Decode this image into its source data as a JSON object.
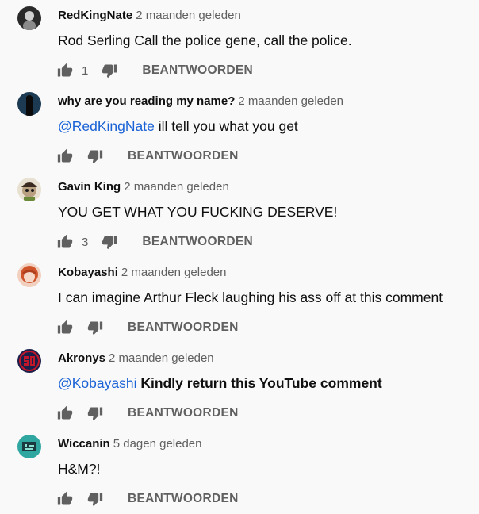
{
  "comments": [
    {
      "author": "RedKingNate",
      "time": "2 maanden geleden",
      "mention": "",
      "text": "Rod Serling Call the police gene, call the police.",
      "likes": "1",
      "reply_label": "BEANTWOORDEN",
      "avatar_colors": [
        "#2a2a2a",
        "#d0d0d0"
      ]
    },
    {
      "author": "why are you reading my name?",
      "time": "2 maanden geleden",
      "mention": "@RedKingNate",
      "text": " ill tell you what you get",
      "likes": "",
      "reply_label": "BEANTWOORDEN",
      "avatar_colors": [
        "#1c3a52",
        "#0a0a0a"
      ]
    },
    {
      "author": "Gavin King",
      "time": "2 maanden geleden",
      "mention": "",
      "text": "YOU GET WHAT YOU FUCKING DESERVE!",
      "likes": "3",
      "reply_label": "BEANTWOORDEN",
      "avatar_colors": [
        "#e8e0d0",
        "#8a6a4a"
      ]
    },
    {
      "author": "Kobayashi",
      "time": "2 maanden geleden",
      "mention": "",
      "text": "I can imagine Arthur Fleck laughing his ass off at this comment",
      "likes": "",
      "reply_label": "BEANTWOORDEN",
      "avatar_colors": [
        "#f2d0c0",
        "#d0542a"
      ]
    },
    {
      "author": "Akronys",
      "time": "2 maanden geleden",
      "mention": "@Kobayashi",
      "text": " Kindly return this YouTube comment",
      "likes": "",
      "reply_label": "BEANTWOORDEN",
      "avatar_colors": [
        "#1a1f4a",
        "#c0182a"
      ]
    },
    {
      "author": "Wiccanin",
      "time": "5 dagen geleden",
      "mention": "",
      "text": "H&M?!",
      "likes": "",
      "reply_label": "BEANTWOORDEN",
      "avatar_colors": [
        "#2fa6a0",
        "#1a3a40"
      ]
    }
  ]
}
